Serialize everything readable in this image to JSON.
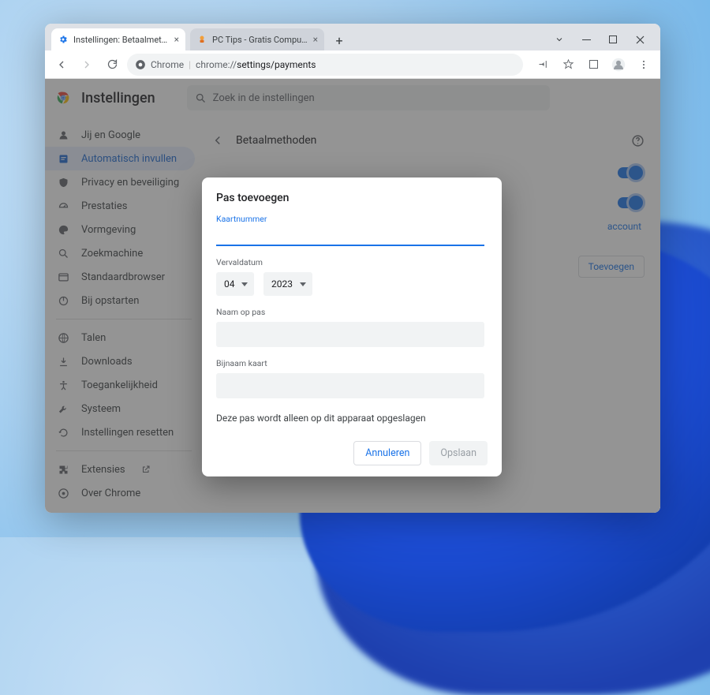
{
  "browser": {
    "tabs": [
      {
        "title": "Instellingen: Betaalmethoden"
      },
      {
        "title": "PC Tips - Gratis Computer Tips, i…"
      }
    ],
    "address": {
      "secure_label": "Chrome",
      "url_prefix": "chrome://",
      "url_path": "settings/payments"
    }
  },
  "settings": {
    "app_title": "Instellingen",
    "search_placeholder": "Zoek in de instellingen",
    "sidebar": {
      "items": [
        {
          "label": "Jij en Google"
        },
        {
          "label": "Automatisch invullen"
        },
        {
          "label": "Privacy en beveiliging"
        },
        {
          "label": "Prestaties"
        },
        {
          "label": "Vormgeving"
        },
        {
          "label": "Zoekmachine"
        },
        {
          "label": "Standaardbrowser"
        },
        {
          "label": "Bij opstarten"
        }
      ],
      "items2": [
        {
          "label": "Talen"
        },
        {
          "label": "Downloads"
        },
        {
          "label": "Toegankelijkheid"
        },
        {
          "label": "Systeem"
        },
        {
          "label": "Instellingen resetten"
        }
      ],
      "items3": [
        {
          "label": "Extensies"
        },
        {
          "label": "Over Chrome"
        }
      ]
    },
    "page": {
      "title": "Betaalmethoden",
      "account_link": "account",
      "add_button": "Toevoegen"
    }
  },
  "dialog": {
    "title": "Pas toevoegen",
    "card_number_label": "Kaartnummer",
    "expiry_label": "Vervaldatum",
    "expiry_month": "04",
    "expiry_year": "2023",
    "name_label": "Naam op pas",
    "nickname_label": "Bijnaam kaart",
    "note": "Deze pas wordt alleen op dit apparaat opgeslagen",
    "cancel": "Annuleren",
    "save": "Opslaan"
  }
}
